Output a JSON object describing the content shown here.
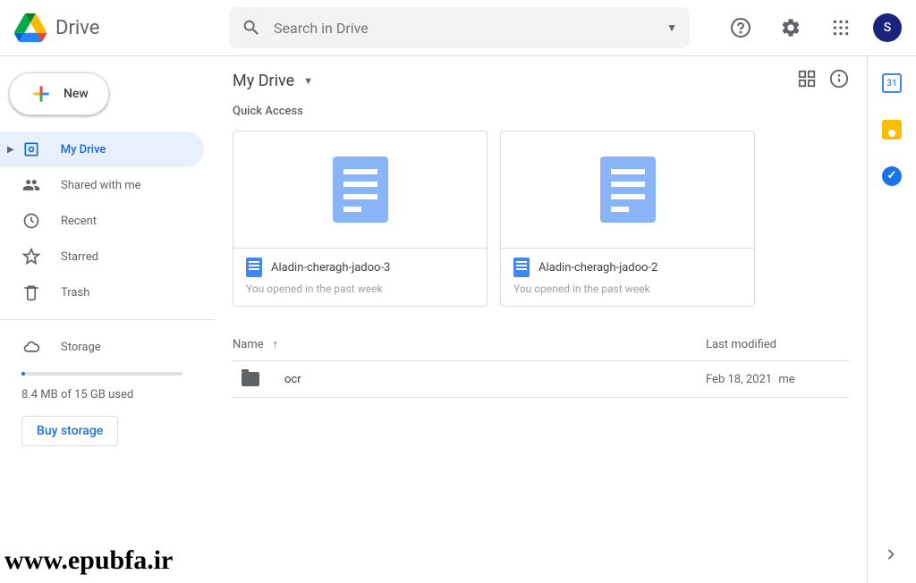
{
  "header": {
    "product": "Drive",
    "search_placeholder": "Search in Drive",
    "avatar_letter": "S"
  },
  "sidebar": {
    "new_label": "New",
    "items": [
      {
        "label": "My Drive"
      },
      {
        "label": "Shared with me"
      },
      {
        "label": "Recent"
      },
      {
        "label": "Starred"
      },
      {
        "label": "Trash"
      }
    ],
    "storage_label": "Storage",
    "storage_usage": "8.4 MB of 15 GB used",
    "buy_label": "Buy storage"
  },
  "main": {
    "breadcrumb": "My Drive",
    "quick_access_title": "Quick Access",
    "quick_items": [
      {
        "name": "Aladin-cheragh-jadoo-3",
        "sub": "You opened in the past week"
      },
      {
        "name": "Aladin-cheragh-jadoo-2",
        "sub": "You opened in the past week"
      }
    ],
    "columns": {
      "name": "Name",
      "modified": "Last modified"
    },
    "rows": [
      {
        "name": "ocr",
        "modified": "Feb 18, 2021",
        "owner": "me"
      }
    ]
  },
  "sidepanel": {
    "calendar_day": "31"
  },
  "watermark": "www.epubfa.ir"
}
